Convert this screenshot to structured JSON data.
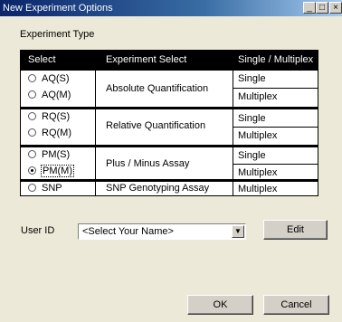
{
  "window": {
    "title": "New Experiment Options",
    "controls": {
      "minimize": "_",
      "maximize": "□",
      "close": "×"
    }
  },
  "experiment_type": {
    "label": "Experiment Type",
    "columns": [
      "Select",
      "Experiment Select",
      "Single / Multiplex"
    ],
    "groups": [
      {
        "options": [
          "AQ(S)",
          "AQ(M)"
        ],
        "description": "Absolute Quantification",
        "types": [
          "Single",
          "Multiplex"
        ]
      },
      {
        "options": [
          "RQ(S)",
          "RQ(M)"
        ],
        "description": "Relative Quantification",
        "types": [
          "Single",
          "Multiplex"
        ]
      },
      {
        "options": [
          "PM(S)",
          "PM(M)"
        ],
        "description": "Plus / Minus Assay",
        "types": [
          "Single",
          "Multiplex"
        ]
      },
      {
        "options": [
          "SNP"
        ],
        "description": "SNP Genotyping Assay",
        "types": [
          "Multiplex"
        ]
      }
    ],
    "selected": "PM(M)"
  },
  "user": {
    "label": "User ID",
    "value": "<Select Your Name>",
    "edit_label": "Edit"
  },
  "footer": {
    "ok_label": "OK",
    "cancel_label": "Cancel"
  }
}
